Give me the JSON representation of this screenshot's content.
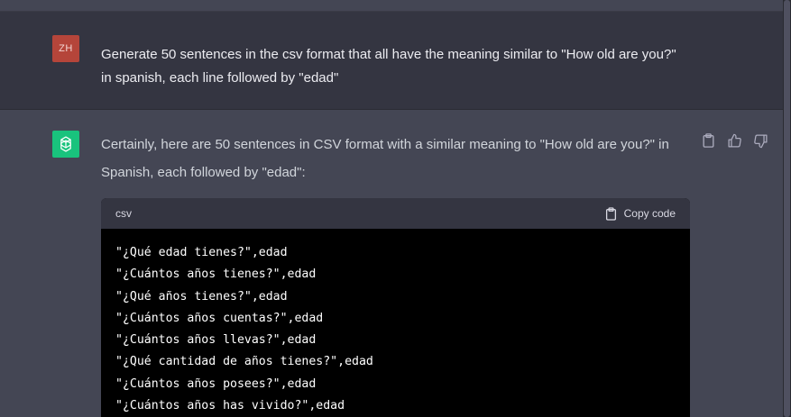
{
  "user_message": {
    "avatar_initials": "ZH",
    "text": "Generate 50 sentences in the csv format that all have the meaning similar to \"How old are you?\" in spanish, each line followed by \"edad\""
  },
  "assistant_message": {
    "avatar_icon": "openai-logo-icon",
    "intro_text": "Certainly, here are 50 sentences in CSV format with a similar meaning to \"How old are you?\" in Spanish, each followed by \"edad\":",
    "actions": [
      "clipboard-icon",
      "thumbs-up-icon",
      "thumbs-down-icon"
    ],
    "code_block": {
      "language": "csv",
      "copy_label": "Copy code",
      "lines": [
        "\"¿Qué edad tienes?\",edad",
        "\"¿Cuántos años tienes?\",edad",
        "\"¿Qué años tienes?\",edad",
        "\"¿Cuántos años cuentas?\",edad",
        "\"¿Cuántos años llevas?\",edad",
        "\"¿Qué cantidad de años tienes?\",edad",
        "\"¿Cuántos años posees?\",edad",
        "\"¿Cuántos años has vivido?\",edad"
      ]
    }
  },
  "colors": {
    "user_bg": "#343541",
    "assistant_bg": "#444654",
    "user_avatar": "#b5453a",
    "bot_avatar": "#19c37d",
    "code_bg": "#000000"
  }
}
